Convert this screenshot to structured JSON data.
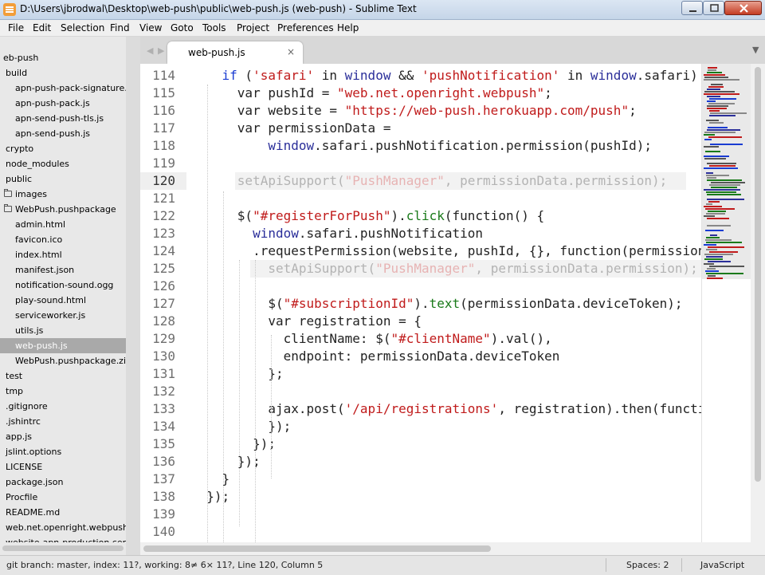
{
  "window": {
    "title": "D:\\Users\\jbrodwal\\Desktop\\web-push\\public\\web-push.js (web-push) - Sublime Text"
  },
  "menu": [
    "File",
    "Edit",
    "Selection",
    "Find",
    "View",
    "Goto",
    "Tools",
    "Project",
    "Preferences",
    "Help"
  ],
  "sidebar": {
    "items": [
      {
        "label": "eb-push",
        "type": "root"
      },
      {
        "label": "build",
        "type": "folder"
      },
      {
        "label": "apn-push-pack-signature.js",
        "type": "file"
      },
      {
        "label": "apn-push-pack.js",
        "type": "file"
      },
      {
        "label": "apn-send-push-tls.js",
        "type": "file"
      },
      {
        "label": "apn-send-push.js",
        "type": "file"
      },
      {
        "label": "crypto",
        "type": "folder"
      },
      {
        "label": "node_modules",
        "type": "folder"
      },
      {
        "label": "public",
        "type": "folder"
      },
      {
        "label": "images",
        "type": "folder"
      },
      {
        "label": "WebPush.pushpackage",
        "type": "folder"
      },
      {
        "label": "admin.html",
        "type": "file"
      },
      {
        "label": "favicon.ico",
        "type": "file"
      },
      {
        "label": "index.html",
        "type": "file"
      },
      {
        "label": "manifest.json",
        "type": "file"
      },
      {
        "label": "notification-sound.ogg",
        "type": "file"
      },
      {
        "label": "play-sound.html",
        "type": "file"
      },
      {
        "label": "serviceworker.js",
        "type": "file"
      },
      {
        "label": "utils.js",
        "type": "file"
      },
      {
        "label": "web-push.js",
        "type": "file",
        "selected": true
      },
      {
        "label": "WebPush.pushpackage.zip",
        "type": "file"
      },
      {
        "label": "test",
        "type": "folder"
      },
      {
        "label": "tmp",
        "type": "folder"
      },
      {
        "label": ".gitignore",
        "type": "file"
      },
      {
        "label": ".jshintrc",
        "type": "file"
      },
      {
        "label": "app.js",
        "type": "file"
      },
      {
        "label": "jslint.options",
        "type": "file"
      },
      {
        "label": "LICENSE",
        "type": "file"
      },
      {
        "label": "package.json",
        "type": "file"
      },
      {
        "label": "Procfile",
        "type": "file"
      },
      {
        "label": "README.md",
        "type": "file"
      },
      {
        "label": "web.net.openright.webpush.",
        "type": "file"
      },
      {
        "label": "website-apn-production.cer",
        "type": "file"
      }
    ]
  },
  "tab": {
    "label": "web-push.js",
    "close_glyph": "×",
    "nav_left": "◀",
    "nav_right": "▶",
    "menu_glyph": "▼"
  },
  "editor": {
    "line_numbers": [
      "114",
      "115",
      "116",
      "117",
      "118",
      "119",
      "120",
      "121",
      "122",
      "123",
      "124",
      "125",
      "126",
      "127",
      "128",
      "129",
      "130",
      "131",
      "132",
      "133",
      "134",
      "135",
      "136",
      "137",
      "138",
      "139",
      "140"
    ],
    "lines": [
      [
        [
          "    ",
          ""
        ],
        [
          "if",
          "kw"
        ],
        [
          " (",
          ""
        ],
        [
          "'safari'",
          "str"
        ],
        [
          " in ",
          ""
        ],
        [
          "window",
          "id"
        ],
        [
          " && ",
          ""
        ],
        [
          "'pushNotification'",
          "str"
        ],
        [
          " in ",
          ""
        ],
        [
          "window",
          "id"
        ],
        [
          ".safari)",
          ""
        ]
      ],
      [
        [
          "      var pushId = ",
          ""
        ],
        [
          "\"web.net.openright.webpush\"",
          "str"
        ],
        [
          ";",
          ""
        ]
      ],
      [
        [
          "      var website = ",
          ""
        ],
        [
          "\"https://web-push.herokuapp.com/push\"",
          "str"
        ],
        [
          ";",
          ""
        ]
      ],
      [
        [
          "      var permissionData =",
          ""
        ]
      ],
      [
        [
          "          ",
          ""
        ],
        [
          "window",
          "id"
        ],
        [
          ".safari.pushNotification.permission(pushId);",
          ""
        ]
      ],
      [
        [
          "",
          ""
        ]
      ],
      [
        [
          "      ",
          ""
        ],
        [
          "setApiSupport(",
          "dim"
        ],
        [
          "\"PushManager\"",
          "dimstr"
        ],
        [
          ", permissionData.permission);",
          "dim"
        ]
      ],
      [
        [
          "",
          ""
        ]
      ],
      [
        [
          "      $(",
          ""
        ],
        [
          "\"#registerForPush\"",
          "str"
        ],
        [
          ").",
          ""
        ],
        [
          "click",
          "fn"
        ],
        [
          "(function() {",
          ""
        ]
      ],
      [
        [
          "        ",
          ""
        ],
        [
          "window",
          "id"
        ],
        [
          ".safari.pushNotification",
          ""
        ]
      ],
      [
        [
          "        .requestPermission(website, pushId, {}, function(permissionData) {",
          ""
        ]
      ],
      [
        [
          "          ",
          ""
        ],
        [
          "setApiSupport(",
          "dim"
        ],
        [
          "\"PushManager\"",
          "dimstr"
        ],
        [
          ", permissionData.permission);",
          "dim"
        ]
      ],
      [
        [
          "",
          ""
        ]
      ],
      [
        [
          "          $(",
          ""
        ],
        [
          "\"#subscriptionId\"",
          "str"
        ],
        [
          ").",
          ""
        ],
        [
          "text",
          "fn"
        ],
        [
          "(permissionData.deviceToken);",
          ""
        ]
      ],
      [
        [
          "          var registration = {",
          ""
        ]
      ],
      [
        [
          "            clientName: $(",
          ""
        ],
        [
          "\"#clientName\"",
          "str"
        ],
        [
          ").val(),",
          ""
        ]
      ],
      [
        [
          "            endpoint: permissionData.deviceToken",
          ""
        ]
      ],
      [
        [
          "          };",
          ""
        ]
      ],
      [
        [
          "",
          ""
        ]
      ],
      [
        [
          "          ajax.post(",
          ""
        ],
        [
          "'/api/registrations'",
          "str"
        ],
        [
          ", registration).then(function() {",
          ""
        ]
      ],
      [
        [
          "          });",
          ""
        ]
      ],
      [
        [
          "        });",
          ""
        ]
      ],
      [
        [
          "      });",
          ""
        ]
      ],
      [
        [
          "    }",
          ""
        ]
      ],
      [
        [
          "  });",
          ""
        ]
      ],
      [
        [
          "",
          ""
        ]
      ],
      [
        [
          "",
          ""
        ]
      ]
    ],
    "current_line": "120"
  },
  "status": {
    "text": "git branch: master, index: 11?, working: 8≠ 6× 11?, Line 120, Column 5",
    "spaces": "Spaces: 2",
    "syntax": "JavaScript"
  },
  "colors": {
    "keyword": "#1a3cd2",
    "string": "#c01b1b",
    "identifier": "#2b2f9a",
    "function": "#1a7a1a",
    "selected_row": "#a9a9a9"
  }
}
